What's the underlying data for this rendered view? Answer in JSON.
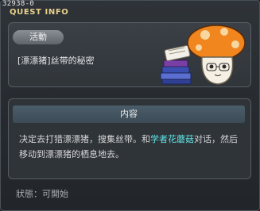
{
  "quest_id": "32938-0",
  "window_title": "QUEST INFO",
  "badge_label": "活動",
  "quest_name": "[漂漂猪]丝带的秘密",
  "content_header": "内容",
  "description": {
    "part1": "决定去打猎漂漂猪，搜集丝带。和",
    "npc_name": "学者花蘑菇",
    "part2": "对话，然后移动到漂漂猪的栖息地去。"
  },
  "status_text": "狀態：可開始",
  "colors": {
    "highlight_npc": "#5fe6e6",
    "title": "#e8d08a"
  }
}
